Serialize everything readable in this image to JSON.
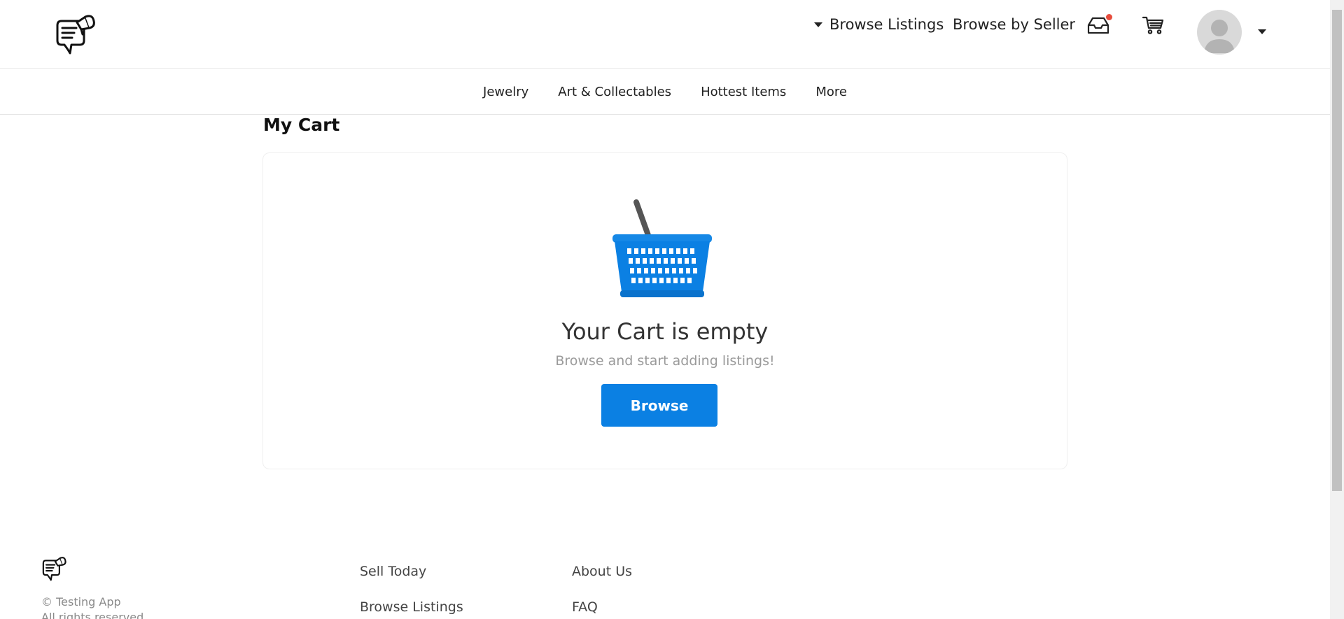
{
  "header": {
    "browse_listings_label": "Browse Listings",
    "browse_by_seller_label": "Browse by Seller",
    "inbox_icon": "inbox-icon",
    "cart_icon": "cart-icon",
    "notification_color": "#e74c3c"
  },
  "categories": {
    "items": [
      {
        "label": "Jewelry"
      },
      {
        "label": "Art & Collectables"
      },
      {
        "label": "Hottest Items"
      },
      {
        "label": "More"
      }
    ]
  },
  "main": {
    "title": "My Cart",
    "empty_title": "Your Cart is empty",
    "empty_subtitle": "Browse and start adding listings!",
    "browse_button_label": "Browse",
    "accent_color": "#0b80e3"
  },
  "footer": {
    "copyright": "© Testing App",
    "rights": "All rights reserved",
    "links_col1": [
      {
        "label": "Sell Today"
      },
      {
        "label": "Browse Listings"
      }
    ],
    "links_col2": [
      {
        "label": "About Us"
      },
      {
        "label": "FAQ"
      }
    ]
  }
}
